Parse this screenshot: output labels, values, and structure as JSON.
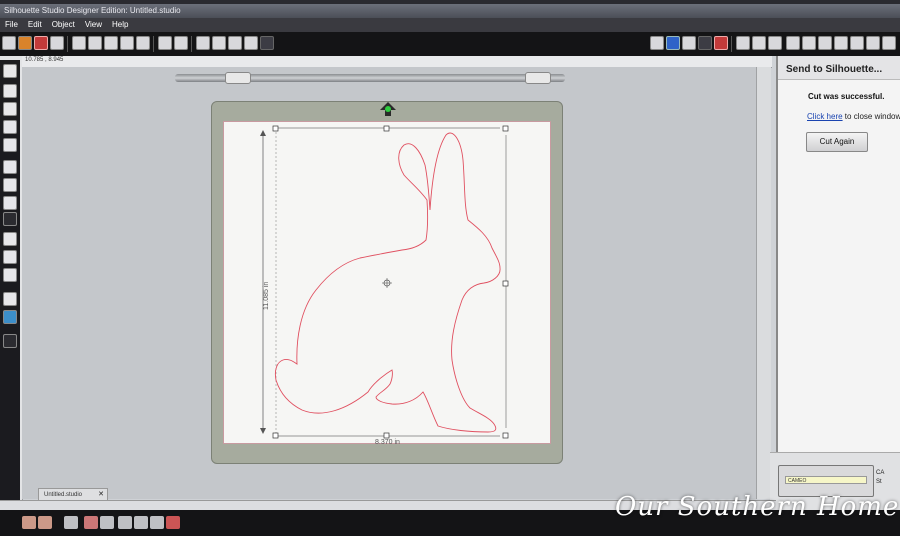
{
  "window": {
    "title": "Silhouette Studio Designer Edition: Untitled.studio"
  },
  "menu": [
    "File",
    "Edit",
    "Object",
    "View",
    "Help"
  ],
  "ruler": {
    "coords": "10.785 , 8.945"
  },
  "selection": {
    "width_label": "8.370 in",
    "height_label": "11.085 in"
  },
  "send_panel": {
    "title": "Send to Silhouette...",
    "status": "Cut was successful.",
    "close_link": "Click here",
    "close_suffix": " to close window",
    "cut_again": "Cut Again"
  },
  "device": {
    "slot_label": "CAMEO",
    "name": "CA",
    "status": "St"
  },
  "document_tab": {
    "label": "Untitled.studio",
    "close": "✕"
  },
  "watermark": {
    "text": "Our Southern Home"
  },
  "colors": {
    "cut_line": "#e05060",
    "feed_arrow": "#2ecc40",
    "mat": "#a6ab9e"
  }
}
